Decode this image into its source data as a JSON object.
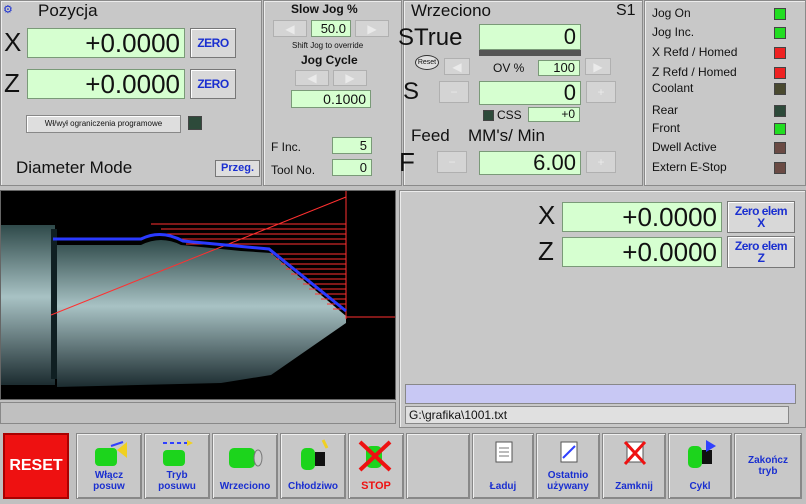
{
  "position": {
    "title": "Pozycja",
    "x_axis": "X",
    "x_value": "+0.0000",
    "z_axis": "Z",
    "z_value": "+0.0000",
    "zero_label": "ZERO",
    "limits_button": "Wł/wył ograniczenia programowe",
    "mode_label": "Diameter Mode",
    "przeg_label": "Przeg."
  },
  "jog": {
    "slow_jog_title": "Slow Jog %",
    "slow_jog_value": "50.0",
    "shift_hint": "Shift Jog to override",
    "jog_cycle_title": "Jog Cycle",
    "jog_cycle_value": "0.1000",
    "f_inc_label": "F Inc.",
    "f_inc_value": "5",
    "tool_no_label": "Tool No.",
    "tool_no_value": "0"
  },
  "spindle": {
    "title": "Wrzeciono",
    "s1_label": "S1",
    "strue_label": "STrue",
    "strue_value": "0",
    "reset_label": "Reset",
    "ov_label": "OV %",
    "ov_value": "100",
    "s_label": "S",
    "s_value": "0",
    "css_label": "CSS",
    "css_value": "+0",
    "feed_label": "Feed",
    "feed_units": "MM's/ Min",
    "f_label": "F",
    "f_value": "6.00"
  },
  "status": [
    {
      "label": "Jog On",
      "color": "#22dd22"
    },
    {
      "label": "Jog Inc.",
      "color": "#22dd22"
    },
    {
      "label": "X Refd / Homed",
      "color": "#ee2222"
    },
    {
      "label": "Z Refd / Homed",
      "color": "#ee2222"
    },
    {
      "label": "Coolant",
      "color": "#4a4a30"
    },
    {
      "label": "Rear",
      "color": "#2d4a3a"
    },
    {
      "label": "Front",
      "color": "#22dd22"
    },
    {
      "label": "Dwell Active",
      "color": "#6a4a44"
    },
    {
      "label": "Extern E-Stop",
      "color": "#6a4a44"
    }
  ],
  "work_offsets": {
    "x_axis": "X",
    "x_value": "+0.0000",
    "z_axis": "Z",
    "z_value": "+0.0000",
    "zero_x_line1": "Zero elem",
    "zero_x_line2": "X",
    "zero_z_line1": "Zero elem",
    "zero_z_line2": "Z"
  },
  "file_path": "G:\\grafika\\1001.txt",
  "toolbar": {
    "reset": "RESET",
    "buttons": [
      {
        "line1": "Włącz",
        "line2": "posuw"
      },
      {
        "line1": "Tryb",
        "line2": "posuwu"
      },
      {
        "line1": "Wrzeciono",
        "line2": ""
      },
      {
        "line1": "Chłodziwo",
        "line2": ""
      },
      {
        "line1": "STOP",
        "line2": ""
      },
      {
        "line1": "Ładuj",
        "line2": ""
      },
      {
        "line1": "Ostatnio",
        "line2": "używany"
      },
      {
        "line1": "Zamknij",
        "line2": ""
      },
      {
        "line1": "Cykl",
        "line2": ""
      },
      {
        "line1": "Zakończ",
        "line2": "tryb"
      }
    ]
  },
  "colors": {
    "dro_bg": "#d6ffd0",
    "accent_blue": "#1a2fd0",
    "reset_red": "#ee1111",
    "viewer_bg": "#000000",
    "path_red": "#ee2222"
  }
}
